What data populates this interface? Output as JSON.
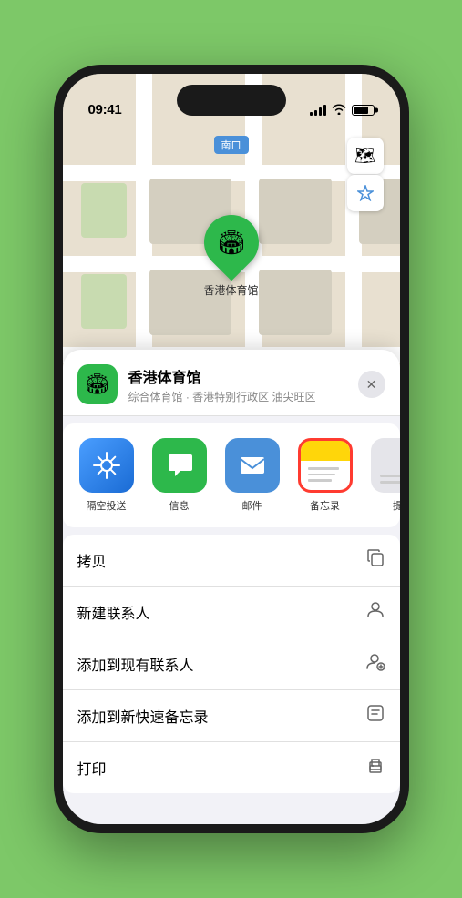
{
  "status": {
    "time": "09:41",
    "location_arrow": "▶"
  },
  "map": {
    "label": "南口",
    "map_btn_layers": "🗺",
    "map_btn_location": "➤"
  },
  "pin": {
    "label": "香港体育馆"
  },
  "location_card": {
    "name": "香港体育馆",
    "subtitle": "综合体育馆 · 香港特别行政区 油尖旺区",
    "close_label": "✕"
  },
  "share_items": [
    {
      "id": "airdrop",
      "label": "隔空投送",
      "selected": false
    },
    {
      "id": "messages",
      "label": "信息",
      "selected": false
    },
    {
      "id": "mail",
      "label": "邮件",
      "selected": false
    },
    {
      "id": "notes",
      "label": "备忘录",
      "selected": true
    },
    {
      "id": "more",
      "label": "提",
      "selected": false
    }
  ],
  "actions": [
    {
      "label": "拷贝",
      "icon": "📋"
    },
    {
      "label": "新建联系人",
      "icon": "👤"
    },
    {
      "label": "添加到现有联系人",
      "icon": "👤"
    },
    {
      "label": "添加到新快速备忘录",
      "icon": "📝"
    },
    {
      "label": "打印",
      "icon": "🖨"
    }
  ]
}
